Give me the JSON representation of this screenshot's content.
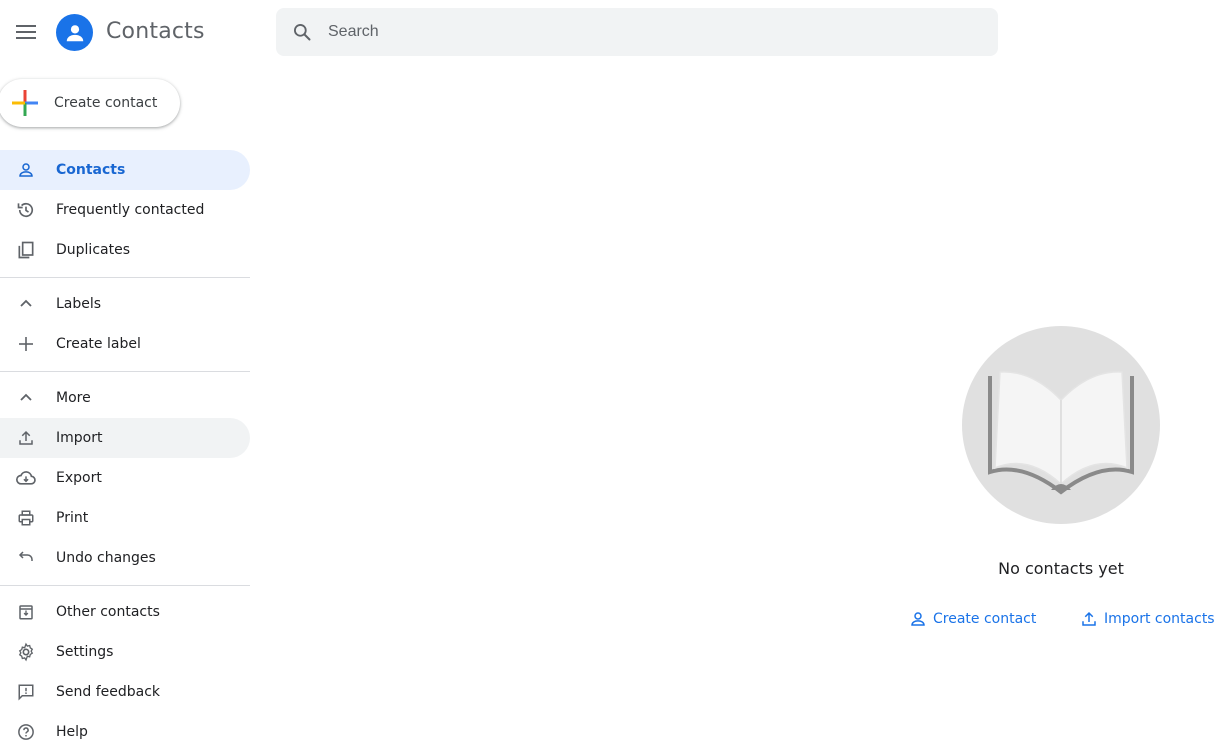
{
  "header": {
    "app_title": "Contacts",
    "search_placeholder": "Search"
  },
  "create_button": {
    "label": "Create contact"
  },
  "sidebar": {
    "items": [
      {
        "label": "Contacts",
        "icon": "person-icon",
        "active": true
      },
      {
        "label": "Frequently contacted",
        "icon": "history-icon"
      },
      {
        "label": "Duplicates",
        "icon": "copy-icon"
      }
    ],
    "labels_section": {
      "label": "Labels",
      "create_label": "Create label"
    },
    "more_section": {
      "label": "More",
      "items": [
        {
          "label": "Import",
          "icon": "upload-icon"
        },
        {
          "label": "Export",
          "icon": "cloud-download-icon"
        },
        {
          "label": "Print",
          "icon": "print-icon"
        },
        {
          "label": "Undo changes",
          "icon": "undo-icon"
        }
      ]
    },
    "footer_items": [
      {
        "label": "Other contacts",
        "icon": "archive-icon"
      },
      {
        "label": "Settings",
        "icon": "gear-icon"
      },
      {
        "label": "Send feedback",
        "icon": "feedback-icon"
      },
      {
        "label": "Help",
        "icon": "help-icon"
      }
    ]
  },
  "empty_state": {
    "message": "No contacts yet",
    "create_link": "Create contact",
    "import_link": "Import contacts"
  },
  "colors": {
    "accent": "#1a73e8",
    "active_bg": "#e8f0fe",
    "hover_bg": "#f1f3f4"
  }
}
